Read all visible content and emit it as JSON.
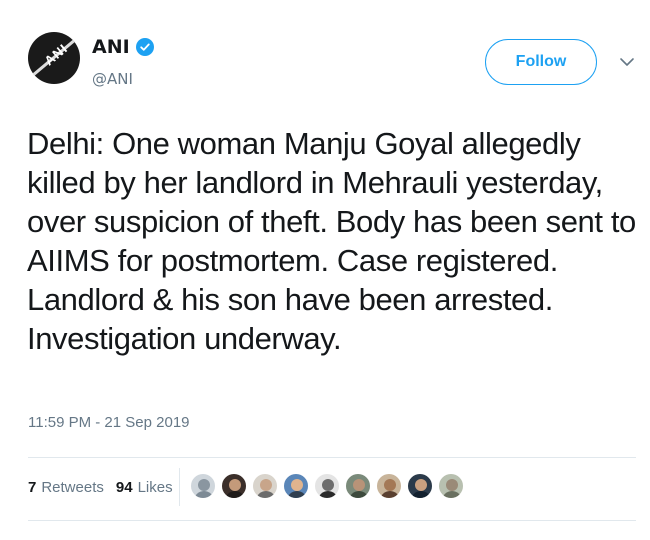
{
  "author": {
    "display_name": "ANI",
    "handle": "@ANI",
    "avatar_logo": "ANI",
    "verified": true
  },
  "follow_button": {
    "label": "Follow"
  },
  "tweet": {
    "text": "Delhi: One woman Manju Goyal allegedly\nkilled by her landlord in Mehrauli yesterday,\nover suspicion of theft. Body has been sent to\nAIIMS for postmortem. Case registered.\nLandlord & his son have been arrested.\nInvestigation underway.",
    "timestamp": "11:59 PM - 21 Sep 2019"
  },
  "stats": {
    "retweets_count": "7",
    "retweets_label": "Retweets",
    "likes_count": "94",
    "likes_label": "Likes"
  },
  "likers": [
    {
      "bg": "#cfd6dc",
      "face": "#8a96a0",
      "body": "#7d8a95"
    },
    {
      "bg": "#3b2f2a",
      "face": "#c49a7a",
      "body": "#1f1b1a"
    },
    {
      "bg": "#d9d4cc",
      "face": "#c8a58a",
      "body": "#6b6b6b"
    },
    {
      "bg": "#5a86b8",
      "face": "#e0b48e",
      "body": "#2f3e4f"
    },
    {
      "bg": "#e4e4e4",
      "face": "#6d6d6d",
      "body": "#2a2a2a"
    },
    {
      "bg": "#7a8a7a",
      "face": "#b89378",
      "body": "#3d4a3d"
    },
    {
      "bg": "#c8b49a",
      "face": "#a47856",
      "body": "#5a4030"
    },
    {
      "bg": "#2b3a4a",
      "face": "#caa080",
      "body": "#12202e"
    },
    {
      "bg": "#b8c0b0",
      "face": "#9a8a78",
      "body": "#6a7060"
    }
  ],
  "colors": {
    "accent": "#1da1f2",
    "secondary_text": "#657786",
    "divider": "#e1e8ed"
  },
  "icons": {
    "verified": "verified-badge-icon",
    "caret": "chevron-down-icon"
  }
}
